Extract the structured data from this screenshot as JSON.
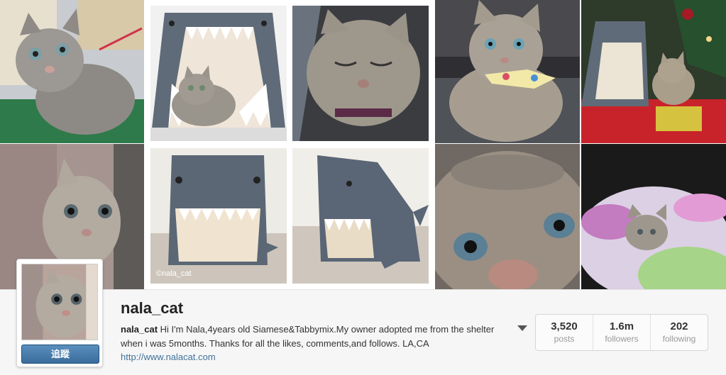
{
  "profile": {
    "username": "nala_cat",
    "bio_handle": "nala_cat",
    "bio_text": "Hi I'm Nala,4years old Siamese&Tabbymix.My owner adopted me from the shelter when i was 5months. Thanks for all the likes, comments,and follows. LA,CA",
    "website": "http://www.nalacat.com",
    "follow_label": "追蹤"
  },
  "stats": [
    {
      "value": "3,520",
      "label": "posts"
    },
    {
      "value": "1.6m",
      "label": "followers"
    },
    {
      "value": "202",
      "label": "following"
    }
  ],
  "photos": {
    "watermark": "©nala_cat"
  },
  "icons": {
    "dropdown": "caret-down-icon"
  },
  "colors": {
    "link": "#3f729b",
    "follow_button": "#3a6c9c"
  }
}
